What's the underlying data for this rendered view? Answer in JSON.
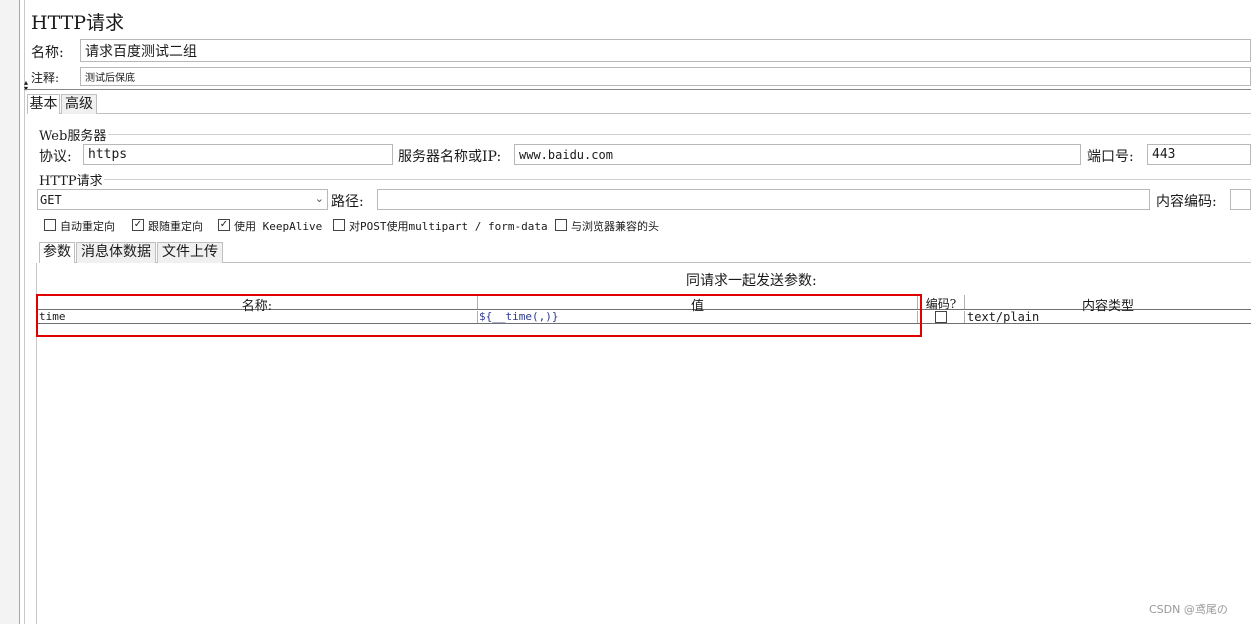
{
  "panel": {
    "title": "HTTP请求"
  },
  "name_row": {
    "label": "名称:",
    "value": "请求百度测试二组"
  },
  "comment_row": {
    "label": "注释:",
    "value": "测试后保底"
  },
  "outer_tabs": [
    {
      "label": "基本"
    },
    {
      "label": "高级"
    }
  ],
  "web_server": {
    "section_title": "Web服务器",
    "protocol_label": "协议:",
    "protocol_value": "https",
    "server_label": "服务器名称或IP:",
    "server_value": "www.baidu.com",
    "port_label": "端口号:",
    "port_value": "443"
  },
  "http_request": {
    "section_title": "HTTP请求",
    "method_value": "GET",
    "path_label": "路径:",
    "path_value": "",
    "encoding_label": "内容编码:",
    "encoding_value": ""
  },
  "options": [
    {
      "label": "自动重定向",
      "checked": false
    },
    {
      "label": "跟随重定向",
      "checked": true
    },
    {
      "label": "使用 KeepAlive",
      "checked": true
    },
    {
      "label": "对POST使用multipart / form-data",
      "checked": false
    },
    {
      "label": "与浏览器兼容的头",
      "checked": false
    }
  ],
  "inner_tabs": [
    {
      "label": "参数"
    },
    {
      "label": "消息体数据"
    },
    {
      "label": "文件上传"
    }
  ],
  "params": {
    "caption": "同请求一起发送参数:",
    "columns": {
      "name": "名称:",
      "value": "值",
      "encode": "编码?",
      "content_type": "内容类型"
    },
    "rows": [
      {
        "name": "time",
        "value": "${__time(,)}",
        "encode": false,
        "content_type": "text/plain"
      }
    ]
  },
  "colors": {
    "highlight": "#e00000",
    "border": "#b8b8b8",
    "panel_bg": "#ffffff"
  },
  "watermark": "CSDN @鸢尾の"
}
